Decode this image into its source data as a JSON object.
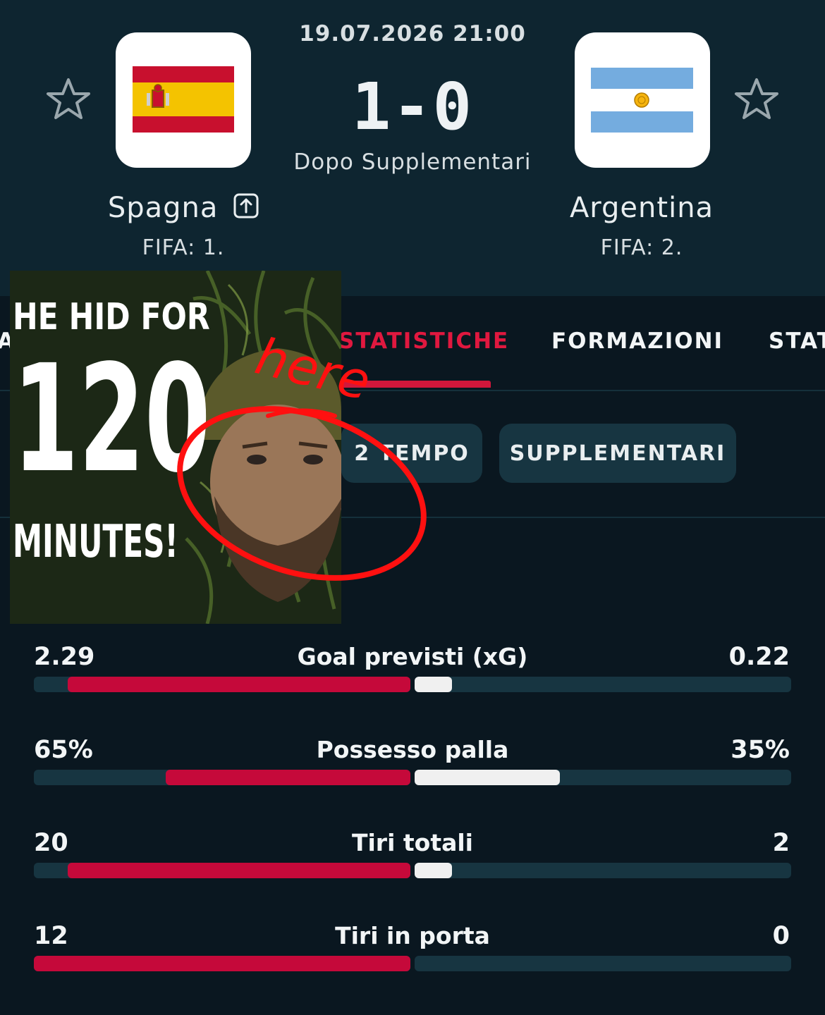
{
  "match": {
    "datetime": "19.07.2026 21:00",
    "score": "1-0",
    "status": "Dopo Supplementari"
  },
  "home": {
    "name": "Spagna",
    "rank": "FIFA: 1.",
    "flag_colors": {
      "red": "#c8102e",
      "yellow": "#f4c300"
    }
  },
  "away": {
    "name": "Argentina",
    "rank": "FIFA: 2.",
    "flag_colors": {
      "blue": "#74acdf",
      "sun": "#f6b40e"
    }
  },
  "tabs": [
    {
      "label": "A"
    },
    {
      "label": "STATISTICHE",
      "active": true
    },
    {
      "label": "FORMAZIONI"
    },
    {
      "label": "STAT"
    }
  ],
  "chips": [
    {
      "label": "2 TEMPO"
    },
    {
      "label": "SUPPLEMENTARI"
    }
  ],
  "stats": [
    {
      "label": "Goal previsti (xG)",
      "home": "2.29",
      "away": "0.22",
      "home_share": 0.91,
      "away_share": 0.09
    },
    {
      "label": "Possesso palla",
      "home": "65%",
      "away": "35%",
      "home_share": 0.65,
      "away_share": 0.35
    },
    {
      "label": "Tiri totali",
      "home": "20",
      "away": "2",
      "home_share": 0.91,
      "away_share": 0.09
    },
    {
      "label": "Tiri in porta",
      "home": "12",
      "away": "0",
      "home_share": 1.0,
      "away_share": 0.0
    }
  ],
  "meme": {
    "line1": "HE HID FOR",
    "line2": "120",
    "line3": "MINUTES!",
    "annotation": "here",
    "annotation_color": "#ff1010"
  },
  "colors": {
    "accent": "#e0183f",
    "bar_home": "#c5093a",
    "bar_away": "#f0f0f0",
    "header_bg": "#0e2530",
    "page_bg": "#0a1720"
  }
}
